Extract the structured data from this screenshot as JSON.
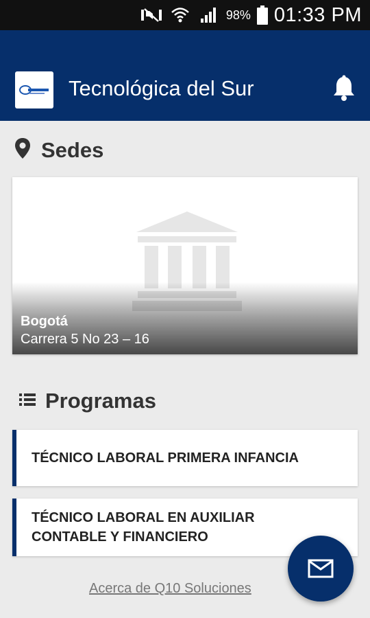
{
  "status_bar": {
    "battery_pct": "98%",
    "time": "01:33 PM",
    "icons": [
      "mute-icon",
      "wifi-icon",
      "signal-icon",
      "battery-icon"
    ]
  },
  "app_bar": {
    "title": "Tecnológica del Sur",
    "logo_icon": "institution-logo",
    "action_icon": "bell-icon"
  },
  "sedes": {
    "title": "Sedes",
    "icon": "location-pin-icon",
    "campus": {
      "city": "Bogotá",
      "address": "Carrera 5 No 23 – 16",
      "image_icon": "building-icon"
    }
  },
  "programas": {
    "title": "Programas",
    "icon": "list-icon",
    "items": [
      {
        "line1": "TÉCNICO LABORAL PRIMERA INFANCIA",
        "line2": ""
      },
      {
        "line1": "TÉCNICO LABORAL EN AUXILIAR",
        "line2": "CONTABLE Y FINANCIERO"
      }
    ]
  },
  "footer": {
    "link_text": "Acerca de Q10 Soluciones"
  },
  "fab": {
    "icon": "mail-icon"
  },
  "colors": {
    "primary": "#062f6b",
    "background": "#ebebeb",
    "status_bar": "#111111"
  }
}
